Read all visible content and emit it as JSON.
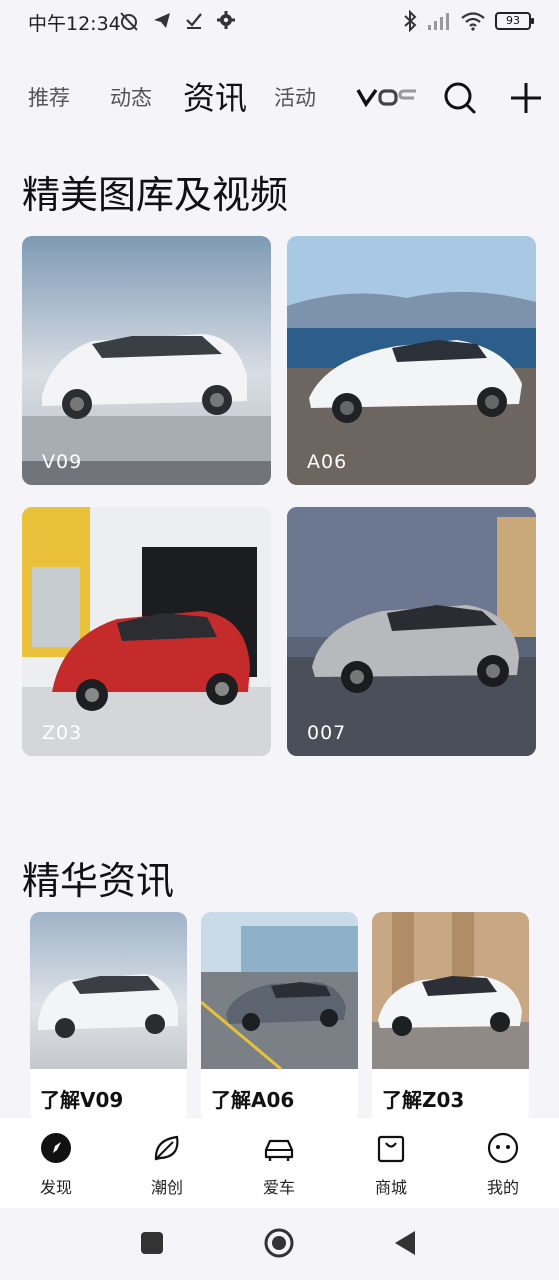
{
  "status_bar": {
    "time": "中午12:34",
    "battery": "93"
  },
  "top_tabs": {
    "items": [
      "推荐",
      "动态",
      "资讯",
      "活动"
    ],
    "active_index": 2,
    "brand_logo_text": "VO9"
  },
  "gallery": {
    "title": "精美图库及视频",
    "cards": [
      {
        "label": "V09"
      },
      {
        "label": "A06"
      },
      {
        "label": "Z03"
      },
      {
        "label": "007"
      }
    ]
  },
  "news": {
    "title": "精华资讯",
    "cards": [
      {
        "title": "了解V09"
      },
      {
        "title": "了解A06"
      },
      {
        "title": "了解Z03"
      }
    ]
  },
  "bottom_nav": {
    "items": [
      {
        "label": "发现",
        "icon": "compass-icon"
      },
      {
        "label": "潮创",
        "icon": "leaf-icon"
      },
      {
        "label": "爱车",
        "icon": "car-icon"
      },
      {
        "label": "商城",
        "icon": "shopping-bag-icon"
      },
      {
        "label": "我的",
        "icon": "face-icon"
      }
    ],
    "active_index": 0
  },
  "colors": {
    "background": "#f4f4f9",
    "text_primary": "#111111",
    "text_secondary": "#555555"
  }
}
